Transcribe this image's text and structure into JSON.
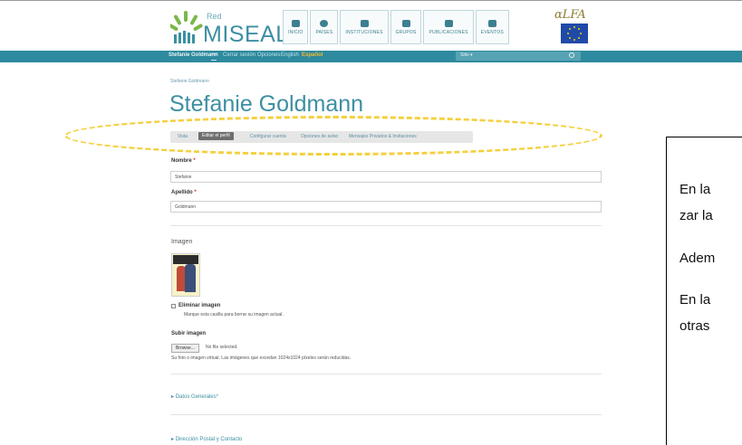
{
  "header": {
    "logo_small": "Red",
    "logo_brand": "MISEAL",
    "nav": [
      "INICIO",
      "PAÍSES",
      "INSTITUCIONES",
      "GRUPOS",
      "PUBLICACIONES",
      "EVENTOS"
    ],
    "alfa_logo": "αLFA"
  },
  "userbar": {
    "username": "Stefanie Goldmann",
    "logout": "Cerrar sesión",
    "options": "Opciones",
    "lang_en": "English",
    "lang_es": "Español",
    "site_select": "Sitio ▾"
  },
  "breadcrumb": "Stefanie Goldmann",
  "page_title": "Stefanie Goldmann",
  "tabs": [
    {
      "label": "Vista"
    },
    {
      "label": "Editar el perfil"
    },
    {
      "label": "Configurar cuenta"
    },
    {
      "label": "Opciones de aviso"
    },
    {
      "label": "Mensajes Privados & Invitaciones"
    }
  ],
  "form": {
    "nombre_label": "Nombre",
    "nombre_value": "Stefanie",
    "apellido_label": "Apellido",
    "apellido_value": "Goldmann",
    "required_mark": "*",
    "imagen_heading": "Imagen",
    "eliminar_label": "Eliminar imagen",
    "eliminar_help": "Marque esta casilla para borrar su imagen actual.",
    "subir_label": "Subir imagen",
    "browse_button": "Browse...",
    "no_file": "No file selected.",
    "upload_help": "Su foto o imagen virtual. Las imágenes que excedan 1024x1024 píxeles serán reducidas.",
    "fieldset_1": "Datos Generales*",
    "fieldset_2": "Dirección Postal y Contacto"
  },
  "side_text": {
    "line1": "En la",
    "line2": "zar la",
    "line3": "Adem",
    "line4": "En la",
    "line5": "otras"
  },
  "colors": {
    "accent": "#2e8a9e",
    "highlight_ellipse": "#f4d03f",
    "active_tab": "#6e6e6e"
  }
}
